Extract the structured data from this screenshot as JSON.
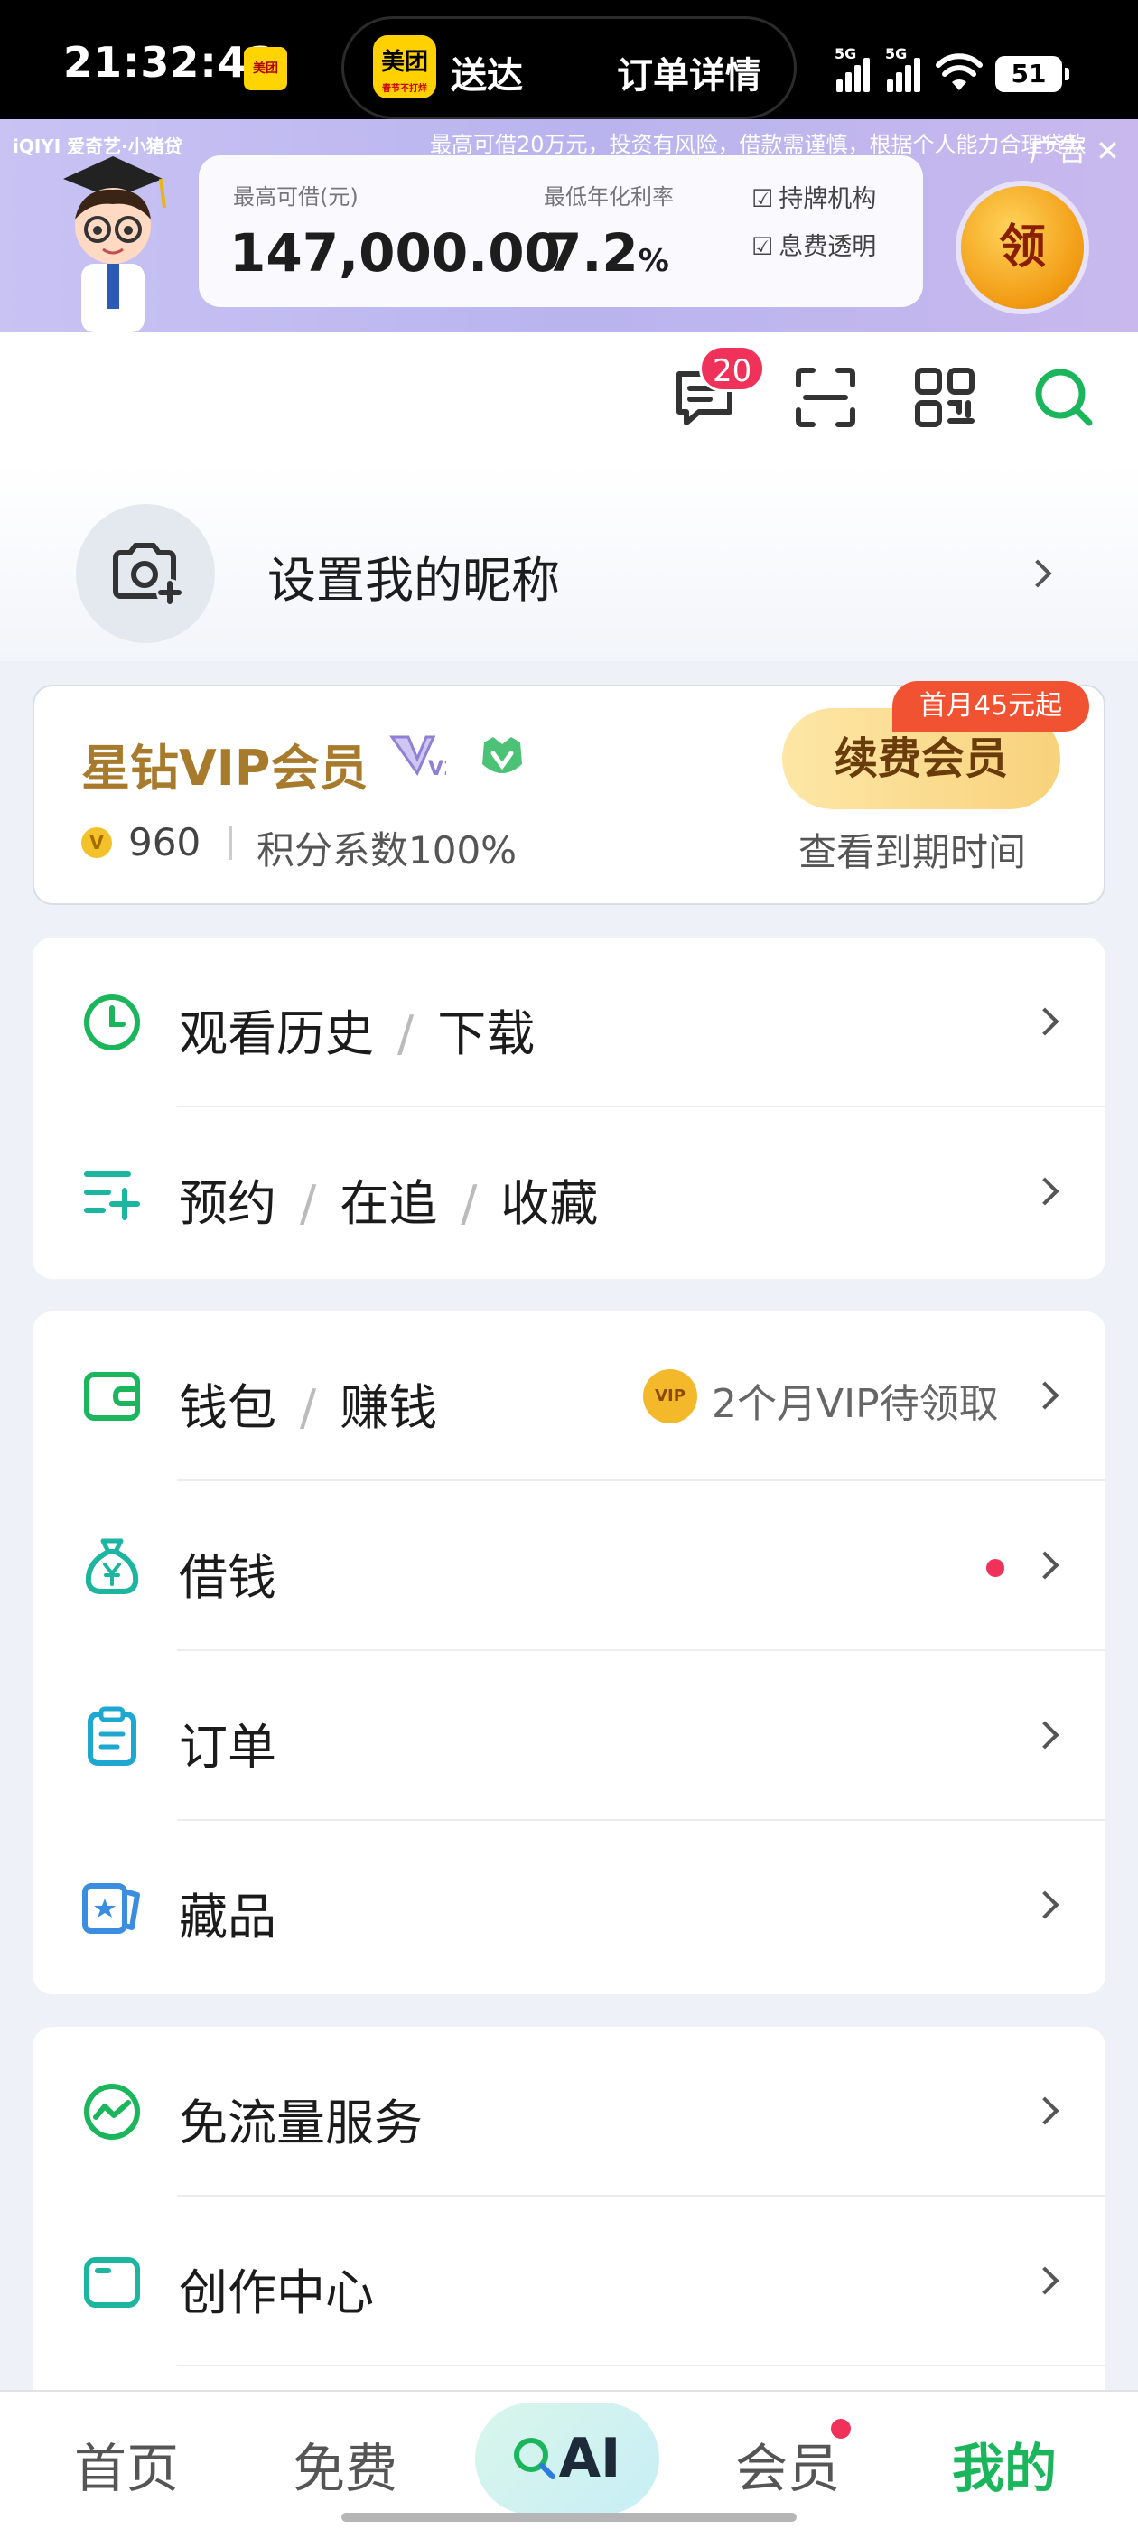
{
  "status_bar": {
    "time": "21:32:43",
    "app_badge": "美团",
    "live_activity": {
      "logo": "美团",
      "logo_sub": "春节不打烊",
      "status": "送达",
      "action": "订单详情"
    },
    "network_1": "5G",
    "network_2": "5G",
    "battery": "51"
  },
  "ad_banner": {
    "brand": "iQIYI 爱奇艺·小猪贷",
    "disclaimer": "最高可借20万元，投资有风险，借款需谨慎，根据个人能力合理贷款",
    "close_text": "广告 ✕",
    "max_loan_label": "最高可借(元)",
    "max_loan_value": "147,000.00",
    "rate_label": "最低年化利率",
    "rate_value": "7.2",
    "rate_unit": "%",
    "check_1": "持牌机构",
    "check_2": "息费透明",
    "claim_button": "领"
  },
  "toolbar": {
    "message_badge": "20",
    "icons": [
      "message-icon",
      "scan-icon",
      "qr-code-icon",
      "search-icon"
    ]
  },
  "profile": {
    "nickname_prompt": "设置我的昵称"
  },
  "vip_card": {
    "title": "星钻VIP会员",
    "level": "V2",
    "points_coin": "V",
    "points": "960",
    "points_ratio": "积分系数100%",
    "renew_button": "续费会员",
    "renew_tag": "首月45元起",
    "expire_link": "查看到期时间"
  },
  "menu_group_1": [
    {
      "parts": [
        "观看历史",
        "下载"
      ],
      "icon": "clock-icon"
    },
    {
      "parts": [
        "预约",
        "在追",
        "收藏"
      ],
      "icon": "list-add-icon"
    }
  ],
  "menu_group_2": {
    "wallet": {
      "parts": [
        "钱包",
        "赚钱"
      ],
      "icon": "wallet-icon",
      "promo_badge": "VIP",
      "promo_text": "2个月VIP待领取"
    },
    "borrow": {
      "label": "借钱",
      "icon": "money-bag-icon"
    },
    "orders": {
      "label": "订单",
      "icon": "clipboard-icon"
    },
    "collectibles": {
      "label": "藏品",
      "icon": "card-star-icon"
    }
  },
  "menu_group_3": [
    {
      "label": "免流量服务",
      "icon": "data-free-icon"
    },
    {
      "label": "创作中心",
      "icon": "creator-icon"
    }
  ],
  "bottom_nav": {
    "home": "首页",
    "free": "免费",
    "ai": "AI",
    "vip": "会员",
    "mine": "我的"
  },
  "colors": {
    "accent_green": "#1bb55c",
    "vip_gold": "#a87a2c",
    "alert_red": "#f0325a",
    "ad_purple": "#c0baf2"
  }
}
